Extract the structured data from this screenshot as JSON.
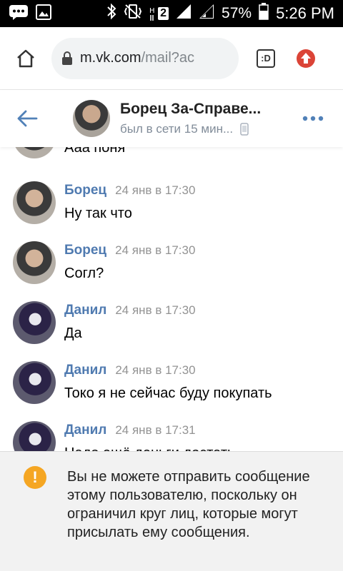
{
  "status_bar": {
    "battery_percent": "57%",
    "time": "5:26 PM",
    "network_label": "2"
  },
  "browser": {
    "url_host": "m.vk.com",
    "url_path": "/mail?ac",
    "tabs_label": ":D"
  },
  "chat_header": {
    "name": "Борец За-Справе...",
    "status": "был в сети 15 мин..."
  },
  "messages": [
    {
      "author": "",
      "time": "",
      "text": "Ааа поня",
      "avatar": "borets"
    },
    {
      "author": "Борец",
      "time": "24 янв в 17:30",
      "text": "Ну так что",
      "avatar": "borets"
    },
    {
      "author": "Борец",
      "time": "24 янв в 17:30",
      "text": "Согл?",
      "avatar": "borets"
    },
    {
      "author": "Данил",
      "time": "24 янв в 17:30",
      "text": "Да",
      "avatar": "danil"
    },
    {
      "author": "Данил",
      "time": "24 янв в 17:30",
      "text": "Токо я не сейчас буду покупать",
      "avatar": "danil"
    },
    {
      "author": "Данил",
      "time": "24 янв в 17:31",
      "text": "Надо ещё деньги достать",
      "avatar": "danil"
    }
  ],
  "notice": {
    "text": "Вы не можете отправить сообщение этому пользователю, поскольку он ограничил круг лиц, которые могут присылать ему сообщения.",
    "icon": "warning-icon"
  },
  "colors": {
    "accent": "#4f7ab0",
    "header_link": "#5181b8",
    "warning": "#f5a623"
  }
}
